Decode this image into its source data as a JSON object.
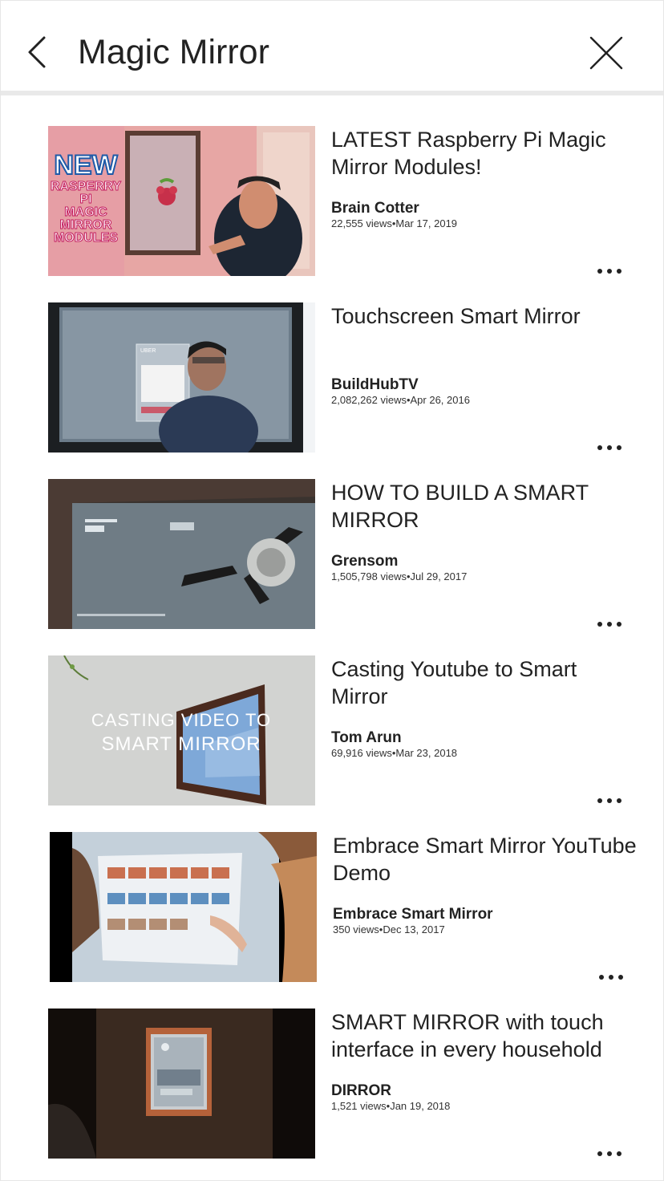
{
  "header": {
    "title": "Magic Mirror",
    "back_icon": "chevron-left-icon",
    "close_icon": "close-icon"
  },
  "videos": [
    {
      "title": "LATEST Raspberry Pi Magic Mirror Modules!",
      "channel": "Brain Cotter",
      "stats": "22,555 views•Mar 17, 2019",
      "thumb_badge": [
        "NEW",
        "RASPERRY",
        "PI",
        "MAGIC",
        "MIRROR",
        "MODULES"
      ],
      "thumb_caption": "",
      "thumb_screen_label": ""
    },
    {
      "title": "Touchscreen Smart Mirror",
      "channel": "BuildHubTV",
      "stats": "2,082,262 views•Apr 26, 2016",
      "thumb_badge": [],
      "thumb_caption": "",
      "thumb_screen_label": "UBER"
    },
    {
      "title": "HOW TO BUILD A SMART MIRROR",
      "channel": "Grensom",
      "stats": "1,505,798 views•Jul 29, 2017",
      "thumb_badge": [],
      "thumb_caption": "",
      "thumb_screen_label": ""
    },
    {
      "title": "Casting Youtube to Smart Mirror",
      "channel": "Tom Arun",
      "stats": "69,916 views•Mar 23, 2018",
      "thumb_badge": [],
      "thumb_caption": "CASTING VIDEO TO SMART MIRROR",
      "thumb_screen_label": ""
    },
    {
      "title": "Embrace Smart Mirror YouTube Demo",
      "channel": "Embrace Smart Mirror",
      "stats": "350 views•Dec 13, 2017",
      "thumb_badge": [],
      "thumb_caption": "",
      "thumb_screen_label": ""
    },
    {
      "title": "SMART MIRROR with touch interface in every household",
      "channel": "DIRROR",
      "stats": "1,521 views•Jan 19, 2018",
      "thumb_badge": [],
      "thumb_caption": "",
      "thumb_screen_label": ""
    }
  ],
  "icons": {
    "more": "more-horizontal-icon"
  }
}
